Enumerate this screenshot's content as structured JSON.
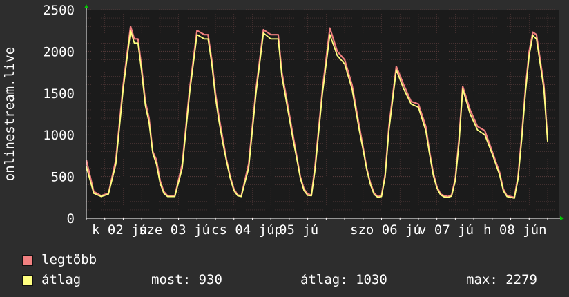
{
  "colors": {
    "background": "#2d2d2d",
    "plot_background": "#1b1b1b",
    "grid": "#5a3c3c",
    "max_series": "#f08080",
    "avg_series": "#ffff80",
    "axis_arrow": "#00cc00"
  },
  "chart_data": {
    "type": "line",
    "ylabel": "onlinestream.live",
    "ylim": [
      0,
      2500
    ],
    "y_ticks": [
      "0",
      "500",
      "1000",
      "1500",
      "2000",
      "2500"
    ],
    "y_tick_values": [
      0,
      500,
      1000,
      1500,
      2000,
      2500
    ],
    "x_tick_labels": [
      {
        "text": "k 02 jú",
        "pos": 0.0
      },
      {
        "text": "sze 03 jú",
        "pos": 0.0
      },
      {
        "text": "cs 04 júp",
        "pos": 0.0
      },
      {
        "text": "05 jú",
        "pos": 0.0
      },
      {
        "text": "szo 06 jú",
        "pos": 0.0
      },
      {
        "text": "v 07 jú",
        "pos": 0.0
      },
      {
        "text": "h 08 jún",
        "pos": 0.0
      }
    ],
    "x_day_fraction": [
      0.0625,
      0.24,
      0.42,
      0.565,
      0.745,
      0.925
    ],
    "x_range_days": [
      0,
      6.4
    ],
    "series": [
      {
        "name": "legtöbb",
        "color": "#f08080",
        "x": [
          0,
          0.1,
          0.2,
          0.3,
          0.4,
          0.5,
          0.6,
          0.65,
          0.7,
          0.75,
          0.8,
          0.85,
          0.9,
          0.95,
          1.0,
          1.05,
          1.1,
          1.2,
          1.3,
          1.4,
          1.5,
          1.6,
          1.65,
          1.7,
          1.75,
          1.8,
          1.85,
          1.9,
          1.95,
          2.0,
          2.05,
          2.1,
          2.2,
          2.3,
          2.4,
          2.5,
          2.6,
          2.65,
          2.7,
          2.75,
          2.8,
          2.85,
          2.9,
          2.95,
          3.0,
          3.05,
          3.1,
          3.2,
          3.3,
          3.4,
          3.5,
          3.6,
          3.65,
          3.7,
          3.75,
          3.8,
          3.85,
          3.9,
          3.95,
          4.0,
          4.05,
          4.1,
          4.2,
          4.3,
          4.4,
          4.5,
          4.6,
          4.65,
          4.7,
          4.75,
          4.8,
          4.85,
          4.9,
          4.95,
          5.0,
          5.05,
          5.1,
          5.2,
          5.3,
          5.4,
          5.5,
          5.6,
          5.65,
          5.7,
          5.75,
          5.8,
          5.85,
          5.9,
          5.95,
          6.0,
          6.05,
          6.1,
          6.2,
          6.25
        ],
        "values": [
          700,
          320,
          270,
          300,
          700,
          1600,
          2300,
          2150,
          2150,
          1800,
          1400,
          1200,
          800,
          700,
          450,
          320,
          270,
          270,
          650,
          1550,
          2250,
          2200,
          2200,
          1900,
          1500,
          1200,
          950,
          700,
          500,
          350,
          280,
          270,
          650,
          1550,
          2260,
          2200,
          2200,
          1750,
          1500,
          1250,
          1000,
          750,
          500,
          350,
          290,
          280,
          630,
          1550,
          2280,
          2000,
          1900,
          1600,
          1350,
          1100,
          850,
          600,
          420,
          300,
          260,
          270,
          530,
          1100,
          1820,
          1600,
          1400,
          1370,
          1100,
          800,
          550,
          380,
          290,
          270,
          260,
          280,
          480,
          950,
          1580,
          1300,
          1100,
          1050,
          800,
          550,
          350,
          270,
          260,
          250,
          500,
          1000,
          1550,
          2000,
          2230,
          2200,
          1600,
          940
        ]
      },
      {
        "name": "átlag",
        "color": "#ffff80",
        "x": [
          0,
          0.1,
          0.2,
          0.3,
          0.4,
          0.5,
          0.6,
          0.65,
          0.7,
          0.75,
          0.8,
          0.85,
          0.9,
          0.95,
          1.0,
          1.05,
          1.1,
          1.2,
          1.3,
          1.4,
          1.5,
          1.6,
          1.65,
          1.7,
          1.75,
          1.8,
          1.85,
          1.9,
          1.95,
          2.0,
          2.05,
          2.1,
          2.2,
          2.3,
          2.4,
          2.5,
          2.6,
          2.65,
          2.7,
          2.75,
          2.8,
          2.85,
          2.9,
          2.95,
          3.0,
          3.05,
          3.1,
          3.2,
          3.3,
          3.4,
          3.5,
          3.6,
          3.65,
          3.7,
          3.75,
          3.8,
          3.85,
          3.9,
          3.95,
          4.0,
          4.05,
          4.1,
          4.2,
          4.3,
          4.4,
          4.5,
          4.6,
          4.65,
          4.7,
          4.75,
          4.8,
          4.85,
          4.9,
          4.95,
          5.0,
          5.05,
          5.1,
          5.2,
          5.3,
          5.4,
          5.5,
          5.6,
          5.65,
          5.7,
          5.75,
          5.8,
          5.85,
          5.9,
          5.95,
          6.0,
          6.05,
          6.1,
          6.2,
          6.25
        ],
        "values": [
          620,
          300,
          260,
          290,
          650,
          1550,
          2250,
          2100,
          2100,
          1750,
          1350,
          1150,
          780,
          650,
          420,
          300,
          260,
          260,
          600,
          1500,
          2200,
          2150,
          2150,
          1850,
          1450,
          1150,
          900,
          680,
          480,
          330,
          270,
          260,
          600,
          1500,
          2220,
          2150,
          2150,
          1700,
          1450,
          1200,
          950,
          720,
          480,
          330,
          275,
          270,
          580,
          1500,
          2200,
          1950,
          1850,
          1550,
          1300,
          1050,
          820,
          580,
          400,
          285,
          250,
          260,
          500,
          1050,
          1780,
          1550,
          1370,
          1330,
          1050,
          770,
          520,
          360,
          280,
          255,
          250,
          265,
          450,
          900,
          1550,
          1250,
          1060,
          1000,
          770,
          520,
          330,
          260,
          250,
          240,
          470,
          950,
          1500,
          1950,
          2190,
          2150,
          1550,
          920
        ]
      }
    ],
    "legend": [
      {
        "label": "legtöbb",
        "color": "#f08080"
      },
      {
        "label": "átlag",
        "color": "#ffff80"
      }
    ],
    "stats": {
      "now": "most: 930",
      "avg": "átlag: 1030",
      "max": "max: 2279"
    }
  }
}
